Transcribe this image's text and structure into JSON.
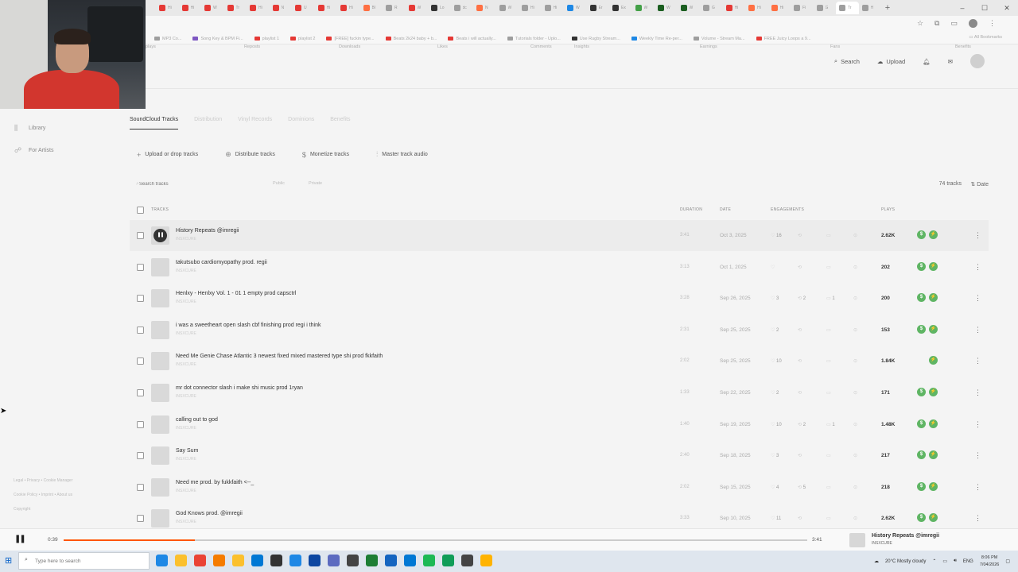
{
  "browser": {
    "tabs": [
      {
        "label": "Hi",
        "color": "#e53935"
      },
      {
        "label": "Hi",
        "color": "#e53935"
      },
      {
        "label": "W",
        "color": "#e53935"
      },
      {
        "label": "Tr",
        "color": "#e53935"
      },
      {
        "label": "Hi",
        "color": "#e53935"
      },
      {
        "label": "N",
        "color": "#e53935"
      },
      {
        "label": "U",
        "color": "#e53935"
      },
      {
        "label": "Hi",
        "color": "#e53935"
      },
      {
        "label": "Hi",
        "color": "#e53935"
      },
      {
        "label": "Bl",
        "color": "#ff7043"
      },
      {
        "label": "R",
        "color": "#9e9e9e"
      },
      {
        "label": "W",
        "color": "#e53935"
      },
      {
        "label": "Lo",
        "color": "#333333"
      },
      {
        "label": "dc",
        "color": "#9e9e9e"
      },
      {
        "label": "N",
        "color": "#ff7043"
      },
      {
        "label": "W",
        "color": "#9e9e9e"
      },
      {
        "label": "Hi",
        "color": "#9e9e9e"
      },
      {
        "label": "Hi",
        "color": "#9e9e9e"
      },
      {
        "label": "W",
        "color": "#1e88e5"
      },
      {
        "label": "Er",
        "color": "#333333"
      },
      {
        "label": "Ex",
        "color": "#333333"
      },
      {
        "label": "W",
        "color": "#43a047"
      },
      {
        "label": "W",
        "color": "#1b5e20"
      },
      {
        "label": "W",
        "color": "#1b5e20"
      },
      {
        "label": "G",
        "color": "#9e9e9e"
      },
      {
        "label": "Hi",
        "color": "#e53935"
      },
      {
        "label": "Hi",
        "color": "#ff7043"
      },
      {
        "label": "Hi",
        "color": "#ff7043"
      },
      {
        "label": "Fi",
        "color": "#9e9e9e"
      },
      {
        "label": "G",
        "color": "#9e9e9e"
      },
      {
        "label": "Tr",
        "color": "#9e9e9e"
      },
      {
        "label": "H",
        "color": "#9e9e9e"
      }
    ],
    "window_controls": [
      "–",
      "☐",
      "✕"
    ],
    "bookmarks": [
      {
        "label": "MP3 Co...",
        "color": "#9e9e9e"
      },
      {
        "label": "Song Key & BPM Fi...",
        "color": "#7e57c2"
      },
      {
        "label": "playlist 1",
        "color": "#e53935"
      },
      {
        "label": "playlist 2",
        "color": "#e53935"
      },
      {
        "label": "[FREE] fuckin type...",
        "color": "#e53935"
      },
      {
        "label": "Beats 2k24 baby + b...",
        "color": "#e53935"
      },
      {
        "label": "Beats i will actually...",
        "color": "#e53935"
      },
      {
        "label": "Tutorials folder - Uplo...",
        "color": "#9e9e9e"
      },
      {
        "label": "Use Rugby Stream...",
        "color": "#333333"
      },
      {
        "label": "Weekly Time Re-per...",
        "color": "#1e88e5"
      },
      {
        "label": "Volume - Stream Ma...",
        "color": "#9e9e9e"
      },
      {
        "label": "FREE Juicy Loops a 9...",
        "color": "#e53935"
      }
    ],
    "all_bookmarks": "All Bookmarks"
  },
  "header": {
    "stats": [
      {
        "num": "",
        "label": "plays"
      },
      {
        "num": "",
        "label": "Reposts"
      },
      {
        "num": "",
        "label": "Downloads"
      },
      {
        "num": "",
        "label": "Likes"
      },
      {
        "num": "",
        "label": "Comments"
      },
      {
        "num": "",
        "label": "Insights"
      },
      {
        "num": "",
        "label": "Earnings"
      },
      {
        "num": "",
        "label": "Fans"
      },
      {
        "num": "",
        "label": "Benefits"
      }
    ],
    "search_label": "Search",
    "upload_label": "Upload"
  },
  "sidebar": {
    "items": [
      {
        "label": "Library"
      },
      {
        "label": "For Artists"
      }
    ],
    "footer": [
      "Legal • Privacy • Cookie Manager",
      "Cookie Policy • Imprint • About us",
      "Copyright"
    ]
  },
  "content": {
    "tabs": [
      "SoundCloud Tracks",
      "Distribution",
      "Vinyl Records",
      "Dominions",
      "Benefits"
    ],
    "actions": [
      "Upload or drop tracks",
      "Distribute tracks",
      "Monetize tracks",
      "Master track audio"
    ],
    "search_placeholder": "Search tracks",
    "filters": [
      "Public",
      "Private"
    ],
    "track_count": "74 tracks",
    "sort_label": "Date",
    "columns": {
      "tracks": "TRACKS",
      "duration": "DURATION",
      "date": "DATE",
      "engagements": "ENGAGEMENTS",
      "plays": "PLAYS"
    }
  },
  "tracks": [
    {
      "title": "History Repeats @imregii",
      "artist": "INSXCURE",
      "duration": "3:41",
      "date": "Oct 3, 2025",
      "likes": "16",
      "reposts": "",
      "comments": "",
      "plays": "2.62K",
      "monetize": true,
      "playing": true
    },
    {
      "title": "takutsubo cardiomyopathy prod. regii",
      "artist": "INSXCURE",
      "duration": "3:13",
      "date": "Oct 1, 2025",
      "likes": "",
      "reposts": "",
      "comments": "",
      "plays": "202",
      "monetize": true,
      "playing": false
    },
    {
      "title": "Henlxy - Henlxy Vol. 1 - 01 1 empty prod capsctrl",
      "artist": "INSXCURE",
      "duration": "3:28",
      "date": "Sep 26, 2025",
      "likes": "3",
      "reposts": "2",
      "comments": "1",
      "plays": "200",
      "monetize": true,
      "playing": false
    },
    {
      "title": "i was a sweetheart open slash cbf finishing prod regi i think",
      "artist": "INSXCURE",
      "duration": "2:31",
      "date": "Sep 25, 2025",
      "likes": "2",
      "reposts": "",
      "comments": "",
      "plays": "153",
      "monetize": true,
      "playing": false
    },
    {
      "title": "Need Me Genie Chase Atlantic  3 newest fixed mixed mastered type shi prod fkkfaith",
      "artist": "INSXCURE",
      "duration": "2:02",
      "date": "Sep 25, 2025",
      "likes": "10",
      "reposts": "",
      "comments": "",
      "plays": "1.84K",
      "monetize": false,
      "playing": false
    },
    {
      "title": "mr dot connector slash i make shi music prod 1ryan",
      "artist": "INSXCURE",
      "duration": "1:33",
      "date": "Sep 22, 2025",
      "likes": "2",
      "reposts": "",
      "comments": "",
      "plays": "171",
      "monetize": true,
      "playing": false
    },
    {
      "title": "calling out to god",
      "artist": "INSXCURE",
      "duration": "1:40",
      "date": "Sep 19, 2025",
      "likes": "10",
      "reposts": "2",
      "comments": "1",
      "plays": "1.48K",
      "monetize": true,
      "playing": false
    },
    {
      "title": "Say Sum",
      "artist": "INSXCURE",
      "duration": "2:40",
      "date": "Sep 18, 2025",
      "likes": "3",
      "reposts": "",
      "comments": "",
      "plays": "217",
      "monetize": true,
      "playing": false
    },
    {
      "title": "Need me prod. by fukkfaith <--_",
      "artist": "INSXCURE",
      "duration": "2:02",
      "date": "Sep 15, 2025",
      "likes": "4",
      "reposts": "5",
      "comments": "",
      "plays": "218",
      "monetize": true,
      "playing": false
    },
    {
      "title": "God Knows prod. @imregii",
      "artist": "INSXCURE",
      "duration": "3:33",
      "date": "Sep 10, 2025",
      "likes": "11",
      "reposts": "",
      "comments": "",
      "plays": "2.62K",
      "monetize": true,
      "playing": false
    }
  ],
  "player": {
    "elapsed": "0:39",
    "total": "3:41",
    "progress_fraction": 0.176,
    "title": "History Repeats @imregii",
    "artist": "INSXCURE"
  },
  "taskbar": {
    "search_placeholder": "Type here to search",
    "apps": [
      "#1e88e5",
      "#fbc02d",
      "#ea4335",
      "#f57c00",
      "#fbc02d",
      "#0078d4",
      "#333333",
      "#1e88e5",
      "#0d47a1",
      "#5c6bc0",
      "#444444",
      "#1e7e34",
      "#1565c0",
      "#0078d4",
      "#1db954",
      "#0f9d58",
      "#444444",
      "#ffb300"
    ],
    "weather": "20°C  Mostly cloudy",
    "lang": "ENG",
    "time": "8:06 PM",
    "date": "7/04/2026"
  }
}
